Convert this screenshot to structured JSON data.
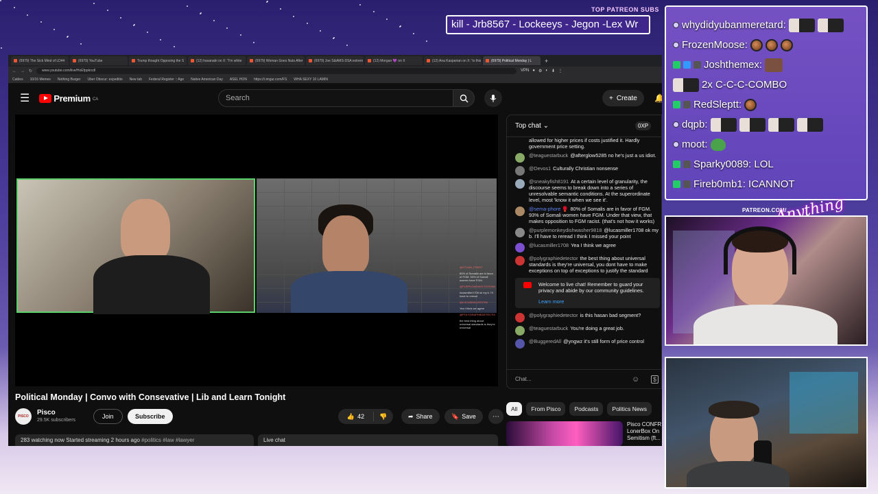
{
  "overlay": {
    "sub_header": "TOP PATREON SUBS",
    "sub_ticker": "kill - Jrb8567 - Lockeeys - Jegon -Lex Wr",
    "patreon_label": "PATREON.COM/",
    "signature": "Anything"
  },
  "browser": {
    "tabs": [
      "(6979) The Sick Mind of LD44",
      "(6979) YouTube",
      "Trump thought Opposing the S",
      "(12) hasanabi on X: \"I'm white",
      "(6979) Woman Goes Nuts After",
      "(6979) Joe S&AMS-DSA extrem",
      "(12) Morgan 💜 on X",
      "(12) Ana Kasparian on X: 'Is this",
      "(6979) Political Monday | L"
    ],
    "active_tab_index": 8,
    "url": "www.youtube.com/live/HoEfppkrcdl",
    "extensions": [
      "VPN",
      "●",
      "⚙",
      "◐",
      "⬇",
      "⋮"
    ],
    "bookmarks": [
      "Cables",
      "10/16 Memes",
      "Nothing Burger",
      "Uber Obscur: expeditio",
      "New tab",
      "Federal Register :: Age",
      "Native American Day",
      "ASEL HON",
      "https://i.imgur.com/FS",
      "WHA SEXY 10 LAMIN"
    ]
  },
  "youtube": {
    "logo_text": "Premium",
    "logo_region": "CA",
    "search_placeholder": "Search",
    "create_label": "Create",
    "video_title": "Political Monday | Convo with Consevative | Lib and Learn Tonight",
    "channel_name": "Pisco",
    "channel_subs": "29.5K subscribers",
    "channel_avatar_text": "PISCO",
    "join_label": "Join",
    "subscribe_label": "Subscribe",
    "like_count": "42",
    "share_label": "Share",
    "save_label": "Save",
    "watching": "283 watching now",
    "started": "Started streaming 2 hours ago",
    "tags": "#politics #law #lawyer",
    "live_chat_label": "Live chat",
    "mini_chat": [
      "@GTUAH_FREDT",
      "80% of Somalis are in favor of FGM. 93% of Somali women have FGM.",
      "@PURPLEMONKEYDISHWASHER",
      "lucasmiller1708 ok my b. I'll have to reread",
      "@LUCASMILLER1708",
      "Yea I think we agree",
      "@POLYGRAPHIEDETECTOR",
      "the best thing about universal standards is they're universal"
    ]
  },
  "chat": {
    "header": "Top chat",
    "xp": "0XP",
    "partial_line": "allowed for higher prices if costs justified it. Hardly government price setting.",
    "messages": [
      {
        "user": "@teaguestarbuck",
        "text": "@afterglow5285 no he's just a us idiot.",
        "color": "#8a6"
      },
      {
        "user": "@Devos1",
        "text": "Culturally Christian nonsense",
        "color": "#777"
      },
      {
        "user": "@sneakyfish8191",
        "text": "At a certain level of granularity, the discourse seems to break down into a series of unresolvable semantic conditions. At the superordinate level, most 'know it when we see it'.",
        "color": "#9ab"
      },
      {
        "user": "@sema-phore 🥊",
        "text": "80% of Somalis are in favor of FGM. 93% of Somali women have FGM. Under that view, that makes opposition to FGM racist. (that's not how it works)",
        "color": "#a86",
        "mod": true
      },
      {
        "user": "@purplemonkeydishwasher9818",
        "text": "@lucasmiller1708 ok my b. I'll have to reread I think I missed your point",
        "color": "#888"
      },
      {
        "user": "@lucasmiller1708",
        "text": "Yea I think we agree",
        "color": "#7b4fcf"
      },
      {
        "user": "@polygraphiedetector",
        "text": "the best thing about universal standards is they're universal, you dont have to make exceptions on top of exceptions to justify the standard",
        "color": "#c33"
      }
    ],
    "welcome_text": "Welcome to live chat! Remember to guard your privacy and abide by our community guidelines.",
    "learn_more": "Learn more",
    "messages_after": [
      {
        "user": "@polygraphiedetector",
        "text": "is this hasan bad segment?",
        "color": "#c33"
      },
      {
        "user": "@teaguestarbuck",
        "text": "You're doing a great job.",
        "color": "#8a6"
      },
      {
        "user": "@BuggeredAll",
        "text": "@yngwz it's still form of price control",
        "color": "#55a"
      }
    ],
    "input_placeholder": "Chat..."
  },
  "related": {
    "chips": [
      "All",
      "From Pisco",
      "Podcasts",
      "Politics News"
    ],
    "rec_title": "Pisco CONFR LonerBox On Semitism (ft..."
  },
  "twitch_chat": [
    {
      "user": "whydidyubanmeretard:",
      "emotes": [
        "dude",
        "dude"
      ]
    },
    {
      "user": "FrozenMoose:",
      "emotes": [
        "brown",
        "brown",
        "brown"
      ]
    },
    {
      "user": "Joshthemex:",
      "emotes": [
        "face"
      ],
      "badges": [
        "#2c6",
        "#39f",
        "#555"
      ]
    },
    {
      "user": "2x C-C-C-COMBO",
      "emotes": [
        "dude"
      ],
      "lead_emote": true
    },
    {
      "user": "RedSleptt:",
      "emotes": [
        "brown"
      ],
      "badges": [
        "#2c6",
        "#555"
      ]
    },
    {
      "user": "dqpb:",
      "emotes": [
        "dude",
        "dude",
        "dude",
        "dude"
      ]
    },
    {
      "user": "moot:",
      "emotes": [
        "frog"
      ]
    },
    {
      "user": "Sparky0089: LOL",
      "emotes": [],
      "badges": [
        "#2c6",
        "#555"
      ]
    },
    {
      "user": "Fireb0mb1: ICANNOT",
      "emotes": [],
      "badges": [
        "#2c6",
        "#555"
      ]
    }
  ]
}
